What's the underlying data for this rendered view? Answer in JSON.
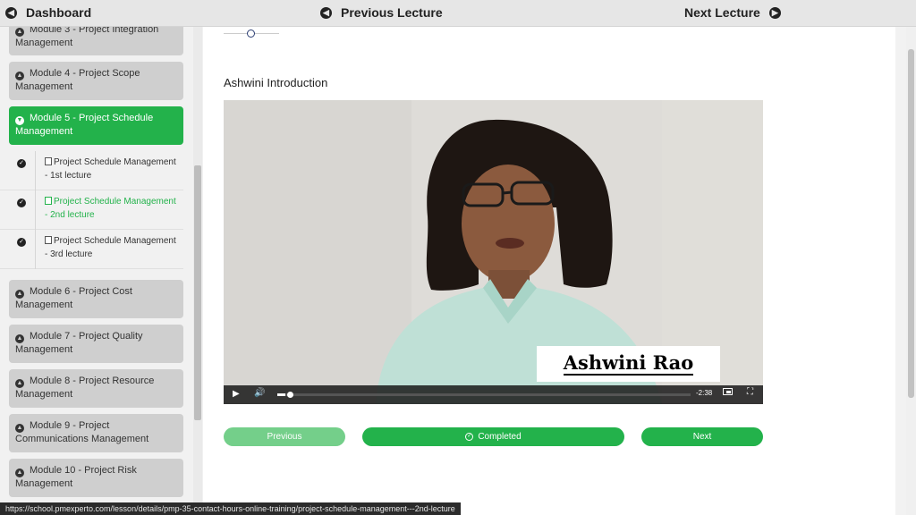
{
  "topbar": {
    "dashboard": "Dashboard",
    "previous_lecture": "Previous Lecture",
    "next_lecture": "Next Lecture"
  },
  "sidebar": {
    "modules": [
      {
        "label": "Module 3 - Project Integration Management"
      },
      {
        "label": "Module 4 - Project Scope Management"
      },
      {
        "label": "Module 5 - Project Schedule Management"
      },
      {
        "label": "Module 6 - Project Cost Management"
      },
      {
        "label": "Module 7 - Project Quality Management"
      },
      {
        "label": "Module 8 - Project Resource Management"
      },
      {
        "label": "Module 9 - Project Communications Management"
      },
      {
        "label": "Module 10 - Project Risk Management"
      }
    ],
    "lectures": [
      {
        "label": "Project Schedule Management - 1st lecture"
      },
      {
        "label": "Project Schedule Management - 2nd lecture"
      },
      {
        "label": "Project Schedule Management - 3rd lecture"
      }
    ]
  },
  "main": {
    "lesson_title": "Ashwini Introduction",
    "video": {
      "name_plate": "Ashwini Rao",
      "time_remaining": "-2:38",
      "progress_fraction": 0.02
    },
    "buttons": {
      "previous": "Previous",
      "completed": "Completed",
      "next": "Next"
    }
  },
  "status_url": "https://school.pmexperto.com/lesson/details/pmp-35-contact-hours-online-training/project-schedule-management---2nd-lecture",
  "colors": {
    "accent": "#23b24b",
    "accent_light": "#74cf8a"
  }
}
